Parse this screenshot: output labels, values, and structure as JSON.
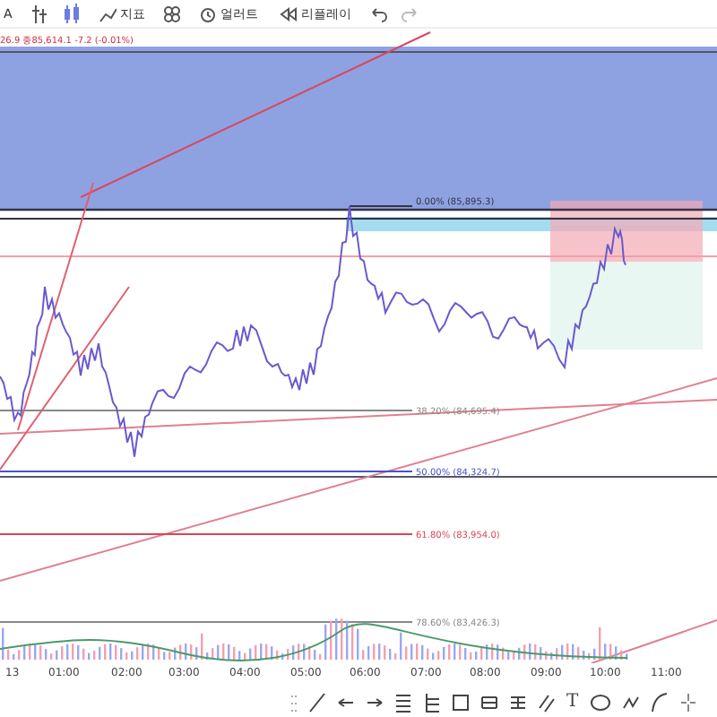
{
  "toolbar": {
    "symbol": "A",
    "indicators_label": "지표",
    "alert_label": "얼러트",
    "replay_label": "리플레이"
  },
  "legend": {
    "text": "26.9 종85,614.1 -7.2 (-0.01%)"
  },
  "fib_levels": [
    {
      "label": "0.00% (85,895.3)",
      "color": "#333344"
    },
    {
      "label": "38.20% (84,695.4)",
      "color": "#888888"
    },
    {
      "label": "50.00% (84,324.7)",
      "color": "#4455cc"
    },
    {
      "label": "61.80% (83,954.0)",
      "color": "#dd4455"
    },
    {
      "label": "78.60% (83,426.3)",
      "color": "#888888"
    }
  ],
  "time_axis": [
    "13",
    "01:00",
    "02:00",
    "03:00",
    "04:00",
    "05:00",
    "06:00",
    "07:00",
    "08:00",
    "09:00",
    "10:00",
    "11:00"
  ],
  "drawing_tools": {
    "text_tool": "T"
  }
}
